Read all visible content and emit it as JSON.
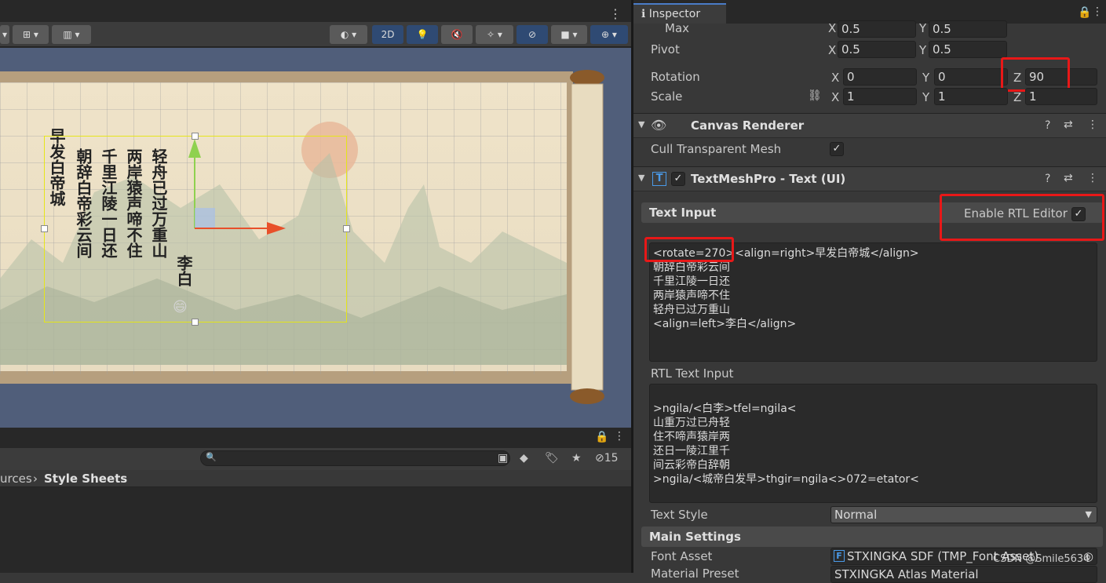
{
  "scene_toolbar": {
    "mode_2d": "2D"
  },
  "poem_display": {
    "title": "早发白帝城",
    "lines": [
      "朝辞白帝彩云间",
      "千里江陵一日还",
      "两岸猿声啼不住",
      "轻舟已过万重山"
    ],
    "author": "李白",
    "emoji": "😄"
  },
  "project_panel": {
    "breadcrumb_prev": "urces",
    "breadcrumb_current": "Style Sheets",
    "hidden_count": "15"
  },
  "inspector": {
    "tab_label": "Inspector",
    "transform": {
      "max_label": "Max",
      "max_x": "0.5",
      "max_y": "0.5",
      "pivot_label": "Pivot",
      "pivot_x": "0.5",
      "pivot_y": "0.5",
      "rotation_label": "Rotation",
      "rotation_x": "0",
      "rotation_y": "0",
      "rotation_z": "90",
      "scale_label": "Scale",
      "scale_x": "1",
      "scale_y": "1",
      "scale_z": "1",
      "axis_x": "X",
      "axis_y": "Y",
      "axis_z": "Z"
    },
    "canvas_renderer": {
      "title": "Canvas Renderer",
      "cull_label": "Cull Transparent Mesh",
      "cull_checked": "✓"
    },
    "textmeshpro": {
      "title": "TextMeshPro - Text (UI)",
      "text_input_header": "Text Input",
      "rtl_editor_label": "Enable RTL Editor",
      "rtl_checked": "✓",
      "text_input": "<rotate=270><align=right>早发白帝城</align>\n朝辞白帝彩云间\n千里江陵一日还\n两岸猿声啼不住\n轻舟已过万重山\n<align=left>李白</align>",
      "rtl_text_input_label": "RTL Text Input",
      "rtl_text_input": "\n>ngila/<白李>tfel=ngila<\n山重万过已舟轻\n住不啼声猿岸两\n还日一陵江里千\n间云彩帝白辞朝\n>ngila/<城帝白发早>thgir=ngila<>072=etator<",
      "text_style_label": "Text Style",
      "text_style_value": "Normal",
      "main_settings_header": "Main Settings",
      "font_asset_label": "Font Asset",
      "font_asset_value": "STXINGKA SDF (TMP_Font Asset)",
      "material_preset_label": "Material Preset",
      "material_preset_value": "STXINGKA Atlas Material"
    }
  },
  "watermark": "CSDN @Smile5634",
  "colors": {
    "highlight_red": "#e81818",
    "selection_yellow": "#e6e61a",
    "tab_accent": "#4a7cc7"
  }
}
